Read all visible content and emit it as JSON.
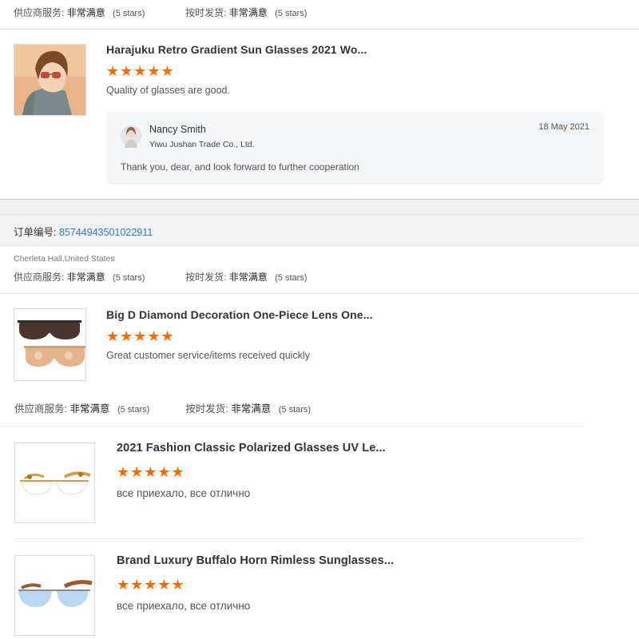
{
  "sections": {
    "top": {
      "supplier_label": "供应商服务:",
      "supplier_value": "非常满意",
      "supplier_stars": "(5 stars)",
      "ship_label": "按时发货:",
      "ship_value": "非常满意",
      "ship_stars": "(5 stars)"
    },
    "product1": {
      "title": "Harajuku Retro Gradient Sun Glasses 2021 Wo...",
      "stars": "★★★★★",
      "review": "Quality of glasses are good.",
      "reply": {
        "name": "Nancy Smith",
        "company": "Yiwu Jushan Trade Co., Ltd.",
        "date": "18 May 2021",
        "text": "Thank you, dear, and look forward to further cooperation"
      }
    },
    "order": {
      "label": "订单编号:",
      "number": "85744943501022911",
      "buyer": "Cherleta Hall,United States",
      "supplier_label": "供应商服务:",
      "supplier_value": "非常满意",
      "supplier_stars": "(5 stars)",
      "ship_label": "按时发货:",
      "ship_value": "非常满意",
      "ship_stars": "(5 stars)"
    },
    "product2": {
      "title": "Big D Diamond Decoration One-Piece Lens One...",
      "stars": "★★★★★",
      "review": "Great customer service/items received quickly"
    },
    "meta3": {
      "supplier_label": "供应商服务:",
      "supplier_value": "非常满意",
      "supplier_stars": "(5 stars)",
      "ship_label": "按时发货:",
      "ship_value": "非常满意",
      "ship_stars": "(5 stars)"
    },
    "product3": {
      "title": "2021 Fashion Classic Polarized Glasses UV Le...",
      "stars": "★★★★★",
      "review": "все приехало, все отлично"
    },
    "product4": {
      "title": "Brand Luxury Buffalo Horn Rimless Sunglasses...",
      "stars": "★★★★★",
      "review": "все приехало, все отлично"
    }
  },
  "colors": {
    "star": "#ff6a00",
    "link": "#2e7bcf",
    "reply_bg": "#f5f6f8"
  },
  "icons": {
    "avatar": "user-avatar-icon"
  }
}
